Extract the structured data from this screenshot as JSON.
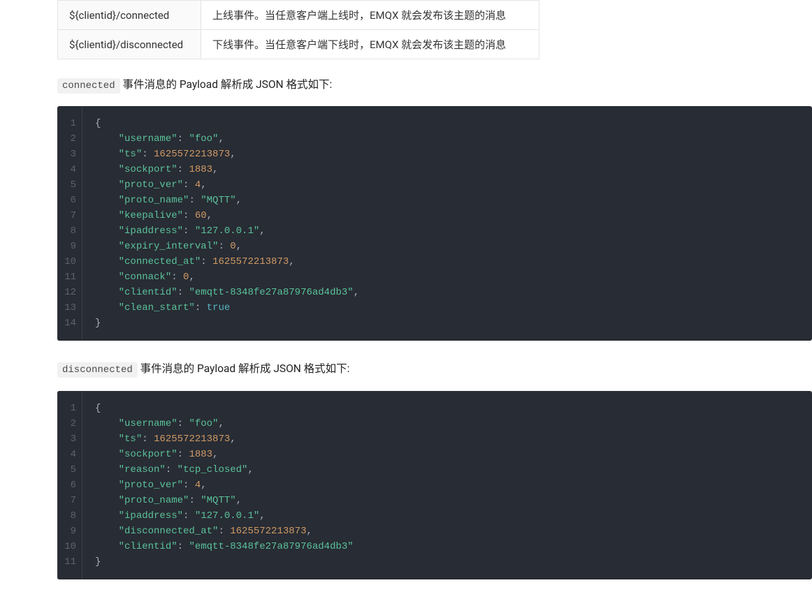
{
  "table": {
    "rows": [
      {
        "topic": "${clientid}/connected",
        "desc": "上线事件。当任意客户端上线时，EMQX 就会发布该主题的消息"
      },
      {
        "topic": "${clientid}/disconnected",
        "desc": "下线事件。当任意客户端下线时，EMQX 就会发布该主题的消息"
      }
    ]
  },
  "section1": {
    "codeTag": "connected",
    "text": " 事件消息的 Payload 解析成 JSON 格式如下:"
  },
  "code1": {
    "lines": [
      [
        {
          "t": "punct",
          "v": "{"
        }
      ],
      [
        {
          "t": "indent",
          "v": "    "
        },
        {
          "t": "key",
          "v": "\"username\""
        },
        {
          "t": "punct",
          "v": ": "
        },
        {
          "t": "str",
          "v": "\"foo\""
        },
        {
          "t": "punct",
          "v": ","
        }
      ],
      [
        {
          "t": "indent",
          "v": "    "
        },
        {
          "t": "key",
          "v": "\"ts\""
        },
        {
          "t": "punct",
          "v": ": "
        },
        {
          "t": "num",
          "v": "1625572213873"
        },
        {
          "t": "punct",
          "v": ","
        }
      ],
      [
        {
          "t": "indent",
          "v": "    "
        },
        {
          "t": "key",
          "v": "\"sockport\""
        },
        {
          "t": "punct",
          "v": ": "
        },
        {
          "t": "num",
          "v": "1883"
        },
        {
          "t": "punct",
          "v": ","
        }
      ],
      [
        {
          "t": "indent",
          "v": "    "
        },
        {
          "t": "key",
          "v": "\"proto_ver\""
        },
        {
          "t": "punct",
          "v": ": "
        },
        {
          "t": "num",
          "v": "4"
        },
        {
          "t": "punct",
          "v": ","
        }
      ],
      [
        {
          "t": "indent",
          "v": "    "
        },
        {
          "t": "key",
          "v": "\"proto_name\""
        },
        {
          "t": "punct",
          "v": ": "
        },
        {
          "t": "str",
          "v": "\"MQTT\""
        },
        {
          "t": "punct",
          "v": ","
        }
      ],
      [
        {
          "t": "indent",
          "v": "    "
        },
        {
          "t": "key",
          "v": "\"keepalive\""
        },
        {
          "t": "punct",
          "v": ": "
        },
        {
          "t": "num",
          "v": "60"
        },
        {
          "t": "punct",
          "v": ","
        }
      ],
      [
        {
          "t": "indent",
          "v": "    "
        },
        {
          "t": "key",
          "v": "\"ipaddress\""
        },
        {
          "t": "punct",
          "v": ": "
        },
        {
          "t": "str",
          "v": "\"127.0.0.1\""
        },
        {
          "t": "punct",
          "v": ","
        }
      ],
      [
        {
          "t": "indent",
          "v": "    "
        },
        {
          "t": "key",
          "v": "\"expiry_interval\""
        },
        {
          "t": "punct",
          "v": ": "
        },
        {
          "t": "num",
          "v": "0"
        },
        {
          "t": "punct",
          "v": ","
        }
      ],
      [
        {
          "t": "indent",
          "v": "    "
        },
        {
          "t": "key",
          "v": "\"connected_at\""
        },
        {
          "t": "punct",
          "v": ": "
        },
        {
          "t": "num",
          "v": "1625572213873"
        },
        {
          "t": "punct",
          "v": ","
        }
      ],
      [
        {
          "t": "indent",
          "v": "    "
        },
        {
          "t": "key",
          "v": "\"connack\""
        },
        {
          "t": "punct",
          "v": ": "
        },
        {
          "t": "num",
          "v": "0"
        },
        {
          "t": "punct",
          "v": ","
        }
      ],
      [
        {
          "t": "indent",
          "v": "    "
        },
        {
          "t": "key",
          "v": "\"clientid\""
        },
        {
          "t": "punct",
          "v": ": "
        },
        {
          "t": "str",
          "v": "\"emqtt-8348fe27a87976ad4db3\""
        },
        {
          "t": "punct",
          "v": ","
        }
      ],
      [
        {
          "t": "indent",
          "v": "    "
        },
        {
          "t": "key",
          "v": "\"clean_start\""
        },
        {
          "t": "punct",
          "v": ": "
        },
        {
          "t": "bool",
          "v": "true"
        }
      ],
      [
        {
          "t": "punct",
          "v": "}"
        }
      ]
    ]
  },
  "section2": {
    "codeTag": "disconnected",
    "text": " 事件消息的 Payload 解析成 JSON 格式如下:"
  },
  "code2": {
    "lines": [
      [
        {
          "t": "punct",
          "v": "{"
        }
      ],
      [
        {
          "t": "indent",
          "v": "    "
        },
        {
          "t": "key",
          "v": "\"username\""
        },
        {
          "t": "punct",
          "v": ": "
        },
        {
          "t": "str",
          "v": "\"foo\""
        },
        {
          "t": "punct",
          "v": ","
        }
      ],
      [
        {
          "t": "indent",
          "v": "    "
        },
        {
          "t": "key",
          "v": "\"ts\""
        },
        {
          "t": "punct",
          "v": ": "
        },
        {
          "t": "num",
          "v": "1625572213873"
        },
        {
          "t": "punct",
          "v": ","
        }
      ],
      [
        {
          "t": "indent",
          "v": "    "
        },
        {
          "t": "key",
          "v": "\"sockport\""
        },
        {
          "t": "punct",
          "v": ": "
        },
        {
          "t": "num",
          "v": "1883"
        },
        {
          "t": "punct",
          "v": ","
        }
      ],
      [
        {
          "t": "indent",
          "v": "    "
        },
        {
          "t": "key",
          "v": "\"reason\""
        },
        {
          "t": "punct",
          "v": ": "
        },
        {
          "t": "str",
          "v": "\"tcp_closed\""
        },
        {
          "t": "punct",
          "v": ","
        }
      ],
      [
        {
          "t": "indent",
          "v": "    "
        },
        {
          "t": "key",
          "v": "\"proto_ver\""
        },
        {
          "t": "punct",
          "v": ": "
        },
        {
          "t": "num",
          "v": "4"
        },
        {
          "t": "punct",
          "v": ","
        }
      ],
      [
        {
          "t": "indent",
          "v": "    "
        },
        {
          "t": "key",
          "v": "\"proto_name\""
        },
        {
          "t": "punct",
          "v": ": "
        },
        {
          "t": "str",
          "v": "\"MQTT\""
        },
        {
          "t": "punct",
          "v": ","
        }
      ],
      [
        {
          "t": "indent",
          "v": "    "
        },
        {
          "t": "key",
          "v": "\"ipaddress\""
        },
        {
          "t": "punct",
          "v": ": "
        },
        {
          "t": "str",
          "v": "\"127.0.0.1\""
        },
        {
          "t": "punct",
          "v": ","
        }
      ],
      [
        {
          "t": "indent",
          "v": "    "
        },
        {
          "t": "key",
          "v": "\"disconnected_at\""
        },
        {
          "t": "punct",
          "v": ": "
        },
        {
          "t": "num",
          "v": "1625572213873"
        },
        {
          "t": "punct",
          "v": ","
        }
      ],
      [
        {
          "t": "indent",
          "v": "    "
        },
        {
          "t": "key",
          "v": "\"clientid\""
        },
        {
          "t": "punct",
          "v": ": "
        },
        {
          "t": "str",
          "v": "\"emqtt-8348fe27a87976ad4db3\""
        }
      ],
      [
        {
          "t": "punct",
          "v": "}"
        }
      ]
    ]
  }
}
